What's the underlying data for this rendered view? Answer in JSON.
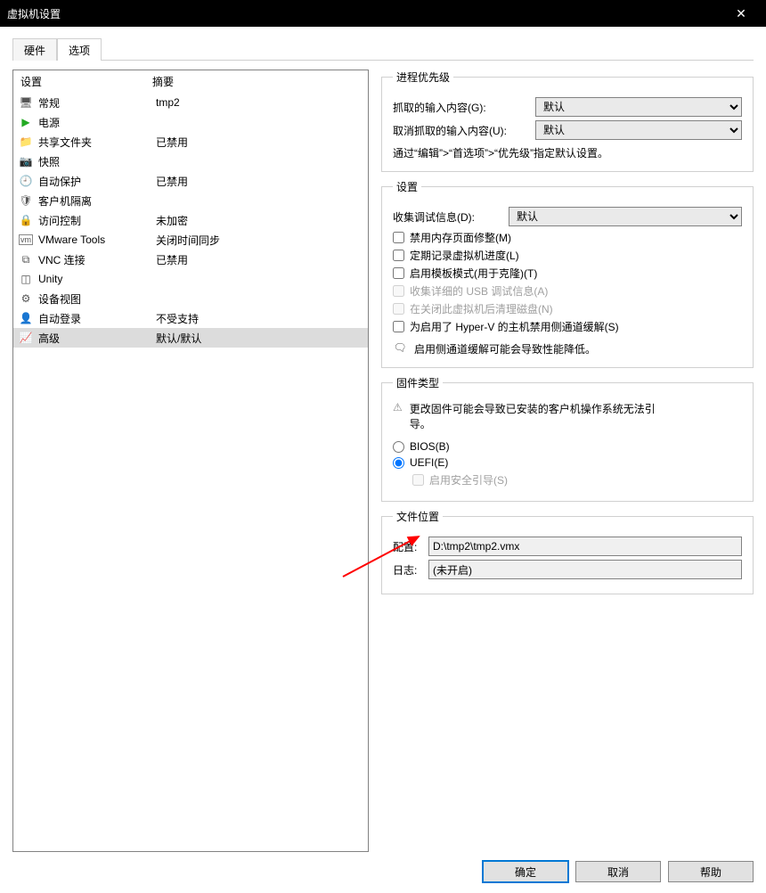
{
  "window": {
    "title": "虚拟机设置"
  },
  "tabs": {
    "hardware": "硬件",
    "options": "选项"
  },
  "list": {
    "hdr_setting": "设置",
    "hdr_summary": "摘要",
    "items": [
      {
        "icon": "monitor",
        "name": "常规",
        "summary": "tmp2"
      },
      {
        "icon": "play",
        "name": "电源",
        "summary": ""
      },
      {
        "icon": "folder",
        "name": "共享文件夹",
        "summary": "已禁用"
      },
      {
        "icon": "camera",
        "name": "快照",
        "summary": ""
      },
      {
        "icon": "clock",
        "name": "自动保护",
        "summary": "已禁用"
      },
      {
        "icon": "shield",
        "name": "客户机隔离",
        "summary": ""
      },
      {
        "icon": "lock",
        "name": "访问控制",
        "summary": "未加密"
      },
      {
        "icon": "vm",
        "name": "VMware Tools",
        "summary": "关闭时间同步"
      },
      {
        "icon": "vnc",
        "name": "VNC 连接",
        "summary": "已禁用"
      },
      {
        "icon": "unity",
        "name": "Unity",
        "summary": ""
      },
      {
        "icon": "device",
        "name": "设备视图",
        "summary": ""
      },
      {
        "icon": "login",
        "name": "自动登录",
        "summary": "不受支持"
      },
      {
        "icon": "adv",
        "name": "高级",
        "summary": "默认/默认"
      }
    ]
  },
  "priority": {
    "legend": "进程优先级",
    "grabbed": "抓取的输入内容(G):",
    "ungrabbed": "取消抓取的输入内容(U):",
    "default": "默认",
    "hint": "通过“编辑”>“首选项”>“优先级”指定默认设置。"
  },
  "settings": {
    "legend": "设置",
    "debug": "收集调试信息(D):",
    "default": "默认",
    "c1": "禁用内存页面修整(M)",
    "c2": "定期记录虚拟机进度(L)",
    "c3": "启用模板模式(用于克隆)(T)",
    "c4": "收集详细的 USB 调试信息(A)",
    "c5": "在关闭此虚拟机后清理磁盘(N)",
    "c6": "为启用了 Hyper-V 的主机禁用侧通道缓解(S)",
    "info": "启用侧通道缓解可能会导致性能降低。"
  },
  "firmware": {
    "legend": "固件类型",
    "warn": "更改固件可能会导致已安装的客户机操作系统无法引导。",
    "bios": "BIOS(B)",
    "uefi": "UEFI(E)",
    "secure": "启用安全引导(S)"
  },
  "fileloc": {
    "legend": "文件位置",
    "config": "配置:",
    "config_val": "D:\\tmp2\\tmp2.vmx",
    "log": "日志:",
    "log_val": "(未开启)"
  },
  "buttons": {
    "ok": "确定",
    "cancel": "取消",
    "help": "帮助"
  }
}
